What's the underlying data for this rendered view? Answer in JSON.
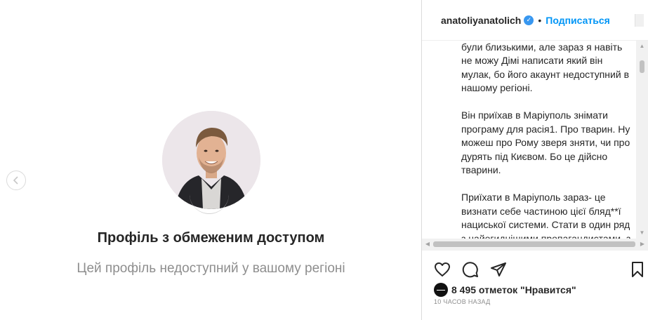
{
  "media": {
    "restricted_title": "Профіль з обмеженим доступом",
    "restricted_subtitle": "Цей профіль недоступний у вашому регіоні",
    "prev_icon": "chevron-left-icon"
  },
  "header": {
    "username": "anatoliyanatolich",
    "verified_icon": "verified-badge-icon",
    "separator": "•",
    "follow_label": "Подписаться"
  },
  "caption": {
    "paragraphs": [
      "питання. Що Діма в Москві. Рідні не були близькими, але зараз я навіть не можу Дімі написати який він мулак, бо його акаунт недоступний в нашому регіоні.",
      "Він приїхав в Маріуполь знімати програму для расія1. Про тварин. Ну можеш про Рому зверя зняти, чи про дурять під Києвом. Бо це дійсно тварини.",
      "Приїхати в Маріуполь зараз- це визнати себе частиною цієї бляд**ї нациської системи. Стати в один ряд з найогиднішими пропагандистами, з якими і дружить Діма."
    ]
  },
  "actions": {
    "like_icon": "heart-icon",
    "comment_icon": "comment-icon",
    "share_icon": "send-icon",
    "save_icon": "bookmark-icon"
  },
  "likes": {
    "text": "8 495 отметок \"Нравится\""
  },
  "timestamp": "10 ЧАСОВ НАЗАД",
  "colors": {
    "accent": "#0095f6",
    "verified": "#3897f0",
    "muted": "#8e8e8e"
  }
}
